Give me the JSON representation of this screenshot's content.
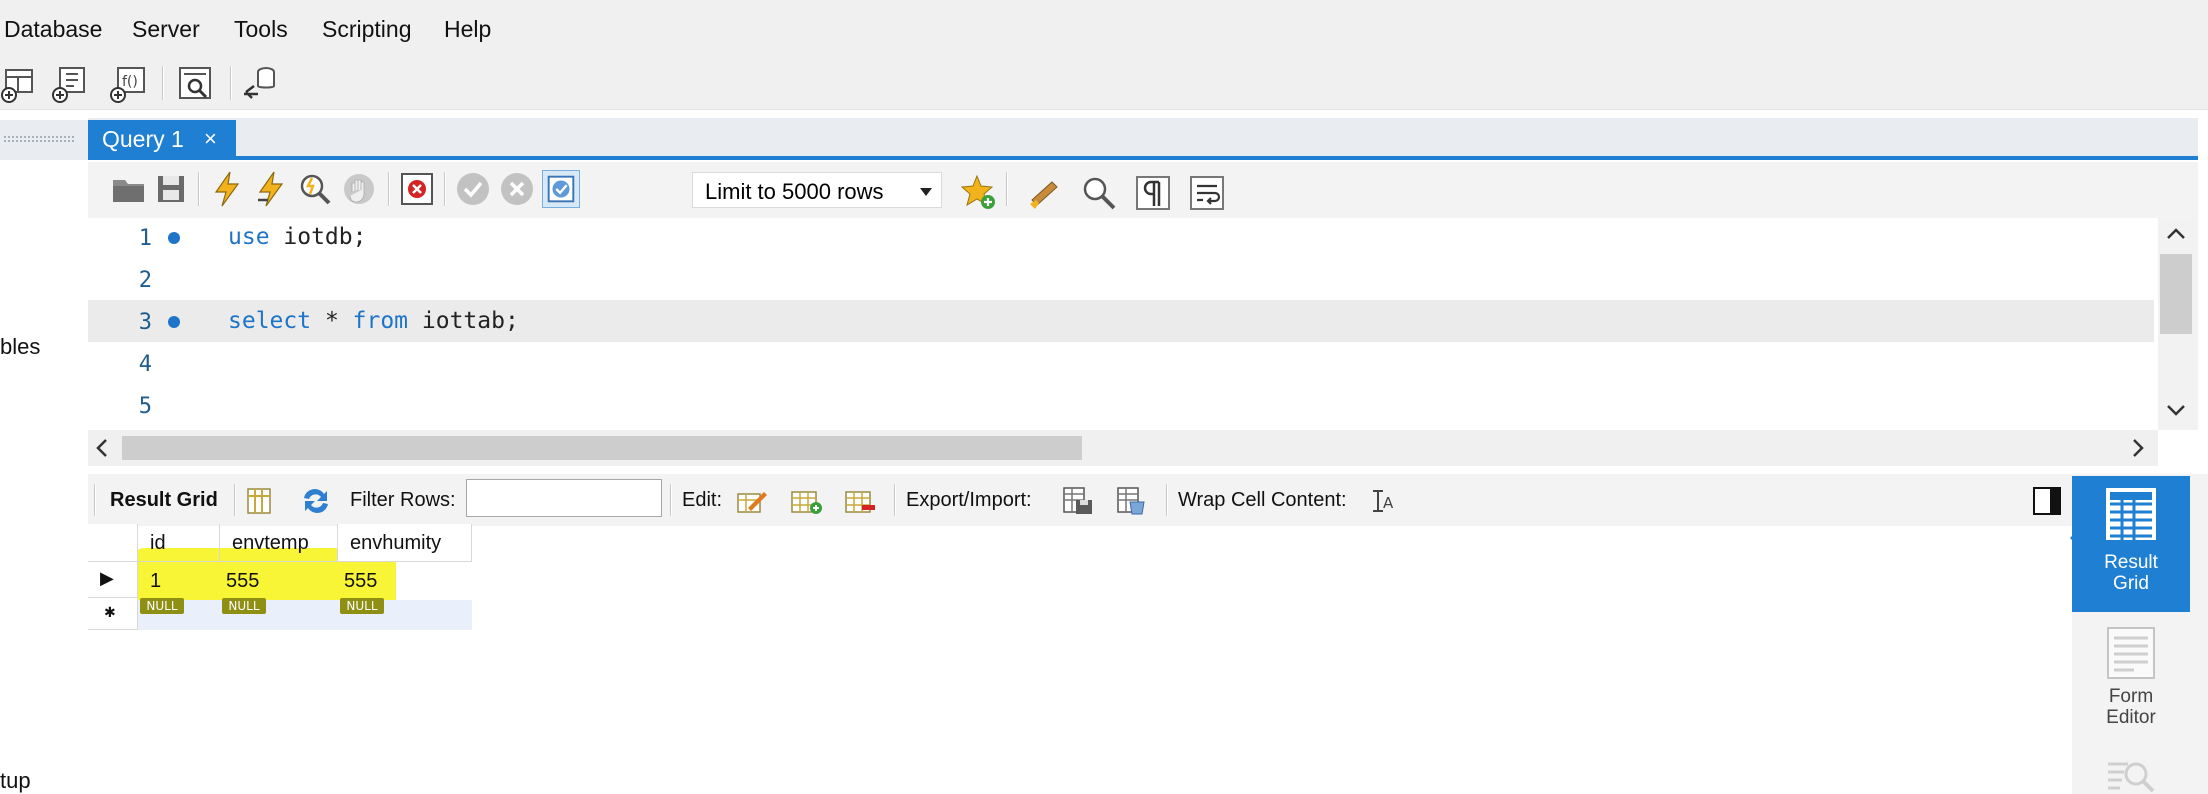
{
  "menu": [
    {
      "label": "Database"
    },
    {
      "label": "Server"
    },
    {
      "label": "Tools"
    },
    {
      "label": "Scripting"
    },
    {
      "label": "Help"
    }
  ],
  "sidebar": {
    "text_1": "bles",
    "text_2": "tup"
  },
  "editor": {
    "tab_label": "Query 1",
    "tab_close": "×",
    "limit_label": "Limit to 5000 rows",
    "lines": [
      {
        "num": "1",
        "keyword": "use",
        "rest": " iotdb;"
      },
      {
        "num": "2"
      },
      {
        "num": "3",
        "keyword": "select",
        "mid": " * ",
        "keyword2": "from",
        "rest": " iottab;"
      },
      {
        "num": "4"
      },
      {
        "num": "5"
      }
    ]
  },
  "result_toolbar": {
    "result_grid_label": "Result Grid",
    "filter_label": "Filter Rows:",
    "filter_value": "",
    "edit_label": "Edit:",
    "export_label": "Export/Import:",
    "wrap_label": "Wrap Cell Content:"
  },
  "grid": {
    "columns": [
      "id",
      "envtemp",
      "envhumity"
    ],
    "rows": [
      [
        "1",
        "555",
        "555"
      ]
    ],
    "null_text": "NULL",
    "new_row_marker": "✱",
    "current_row_marker": "▶"
  },
  "side_panel": {
    "result_grid": "Result\nGrid",
    "result_grid_line1": "Result",
    "result_grid_line2": "Grid",
    "form_editor_line1": "Form",
    "form_editor_line2": "Editor"
  },
  "colors": {
    "accent": "#1e7fd3",
    "keyword": "#1e74c8",
    "highlight": "#f7f42a",
    "null_badge": "#8f8f14"
  }
}
